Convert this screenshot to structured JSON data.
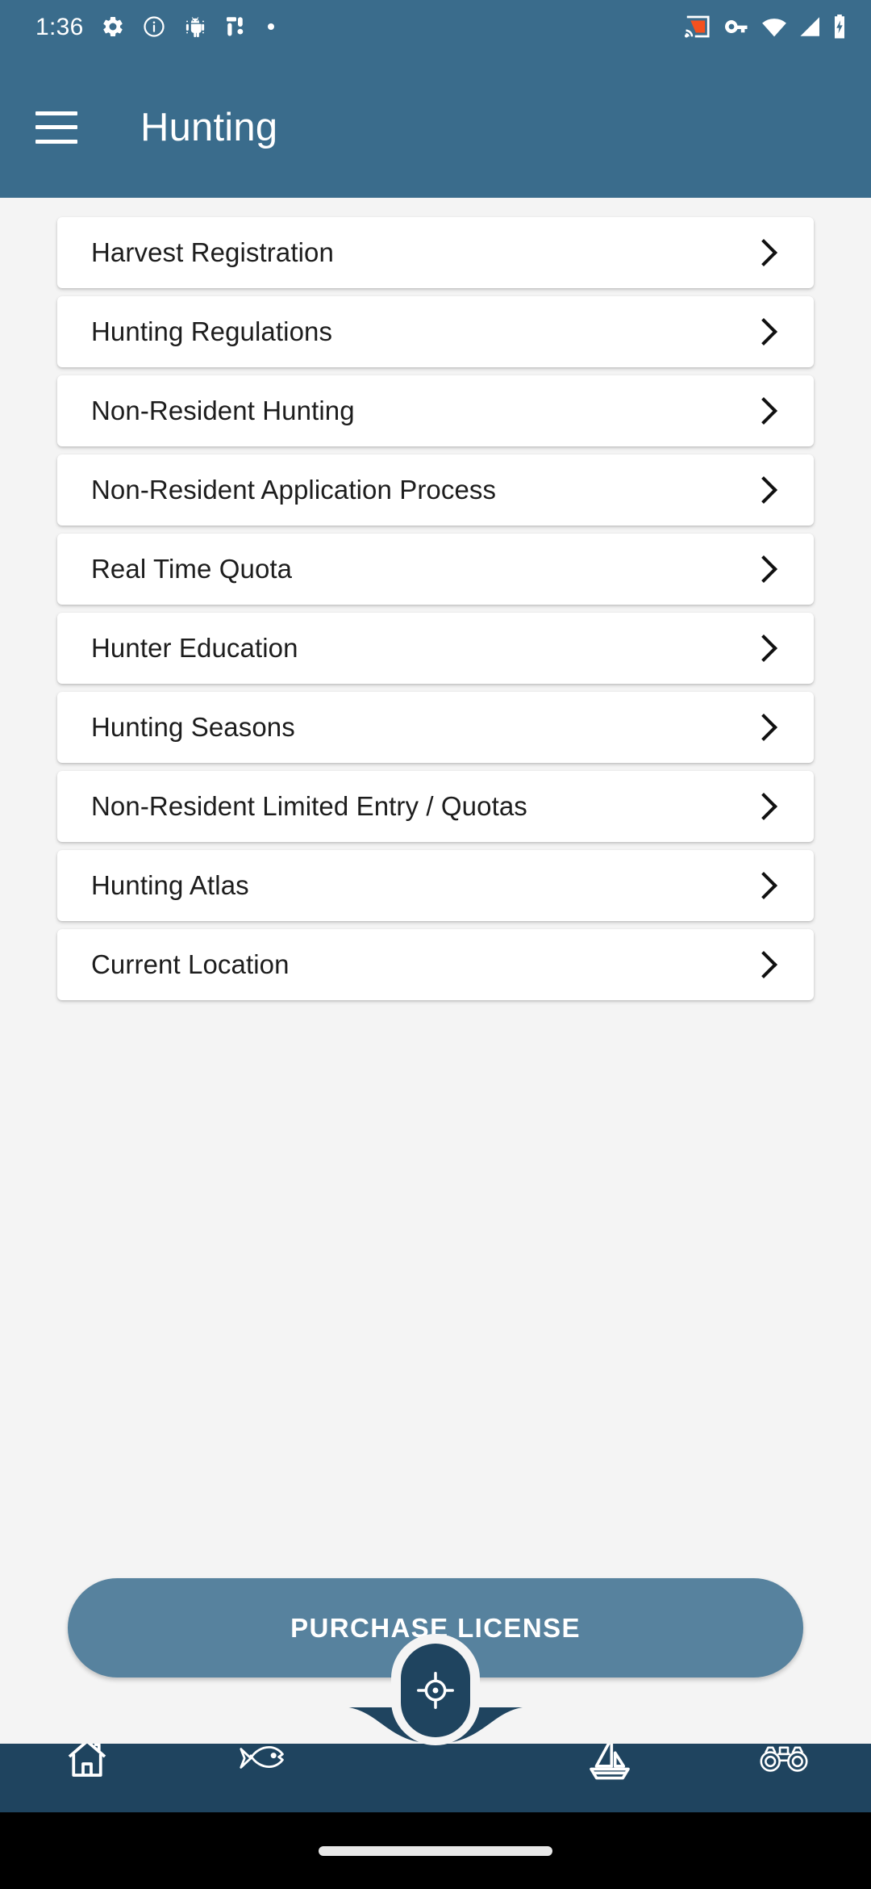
{
  "status_bar": {
    "time": "1:36",
    "left_icons": [
      "gear-icon",
      "info-icon",
      "android-bug-icon",
      "developer-tools-icon",
      "dot-icon"
    ],
    "right_icons": [
      "cast-icon",
      "vpn-key-icon",
      "wifi-icon",
      "cell-signal-icon",
      "battery-charging-icon"
    ],
    "cast_accent_color": "#f4511e"
  },
  "app_bar": {
    "menu_icon": "hamburger-menu-icon",
    "title": "Hunting",
    "background_color": "#3a6c8c"
  },
  "list": {
    "items": [
      {
        "label": "Harvest Registration",
        "chevron": "chevron-right-icon"
      },
      {
        "label": "Hunting Regulations",
        "chevron": "chevron-right-icon"
      },
      {
        "label": "Non-Resident Hunting",
        "chevron": "chevron-right-icon"
      },
      {
        "label": "Non-Resident Application Process",
        "chevron": "chevron-right-icon"
      },
      {
        "label": "Real Time Quota",
        "chevron": "chevron-right-icon"
      },
      {
        "label": "Hunter Education",
        "chevron": "chevron-right-icon"
      },
      {
        "label": "Hunting Seasons",
        "chevron": "chevron-right-icon"
      },
      {
        "label": "Non-Resident Limited Entry / Quotas",
        "chevron": "chevron-right-icon"
      },
      {
        "label": "Hunting Atlas",
        "chevron": "chevron-right-icon"
      },
      {
        "label": "Current Location",
        "chevron": "chevron-right-icon"
      }
    ]
  },
  "primary_action": {
    "label": "PURCHASE LICENSE",
    "background_color": "#57829e"
  },
  "bottom_nav": {
    "background_color": "#1f445f",
    "items": [
      {
        "icon": "home-icon",
        "label": ""
      },
      {
        "icon": "fish-icon",
        "label": ""
      },
      {
        "icon": "sailboat-icon",
        "label": ""
      },
      {
        "icon": "binoculars-icon",
        "label": ""
      }
    ],
    "fab": {
      "icon": "crosshair-target-icon"
    }
  }
}
